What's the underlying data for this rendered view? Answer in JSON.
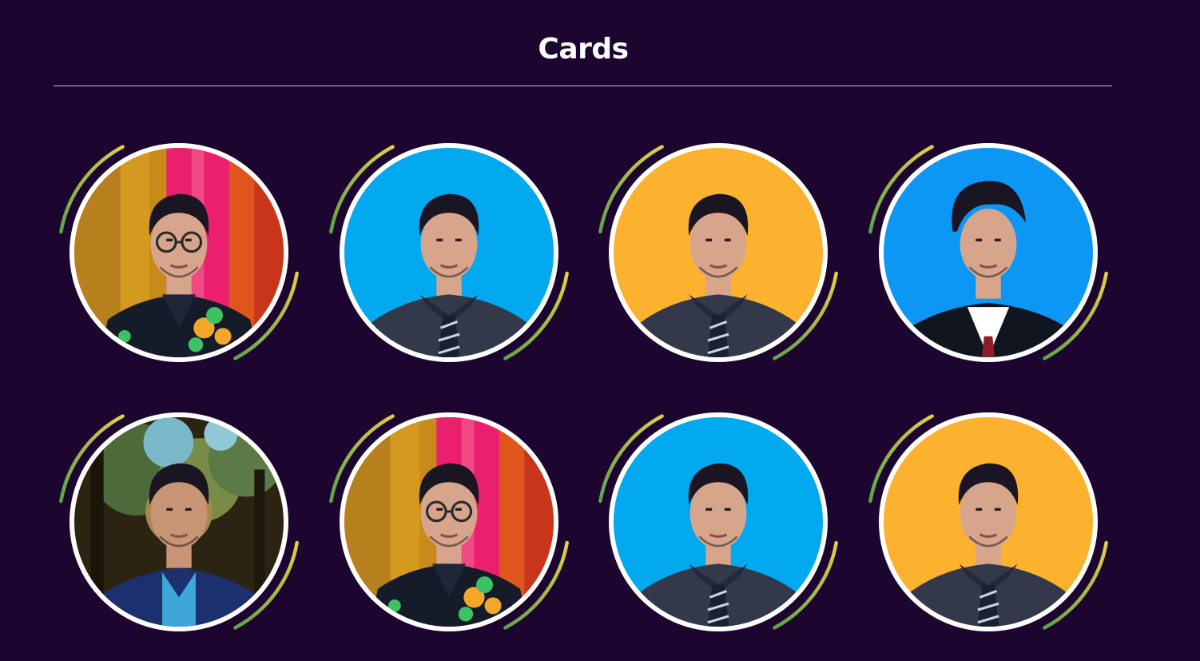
{
  "page": {
    "title": "Cards"
  },
  "theme": {
    "background": "#1c052e",
    "ring": "#ffffff",
    "arc_yellow": "#e2cf45",
    "arc_green": "#5fa24a"
  },
  "cards": [
    {
      "photo": "portrait-photo",
      "background": "festive-curtain",
      "outfit": "dark-embroidered-shirt",
      "glasses": true
    },
    {
      "photo": "portrait-photo",
      "background": "sky-blue",
      "outfit": "dark-shirt-striped-tie",
      "glasses": false
    },
    {
      "photo": "portrait-photo",
      "background": "amber",
      "outfit": "dark-shirt-striped-tie",
      "glasses": false
    },
    {
      "photo": "portrait-photo",
      "background": "bright-blue",
      "outfit": "suit-white-shirt",
      "glasses": false
    },
    {
      "photo": "portrait-photo",
      "background": "trees",
      "outfit": "blue-blazer",
      "glasses": false
    },
    {
      "photo": "portrait-photo",
      "background": "festive-curtain",
      "outfit": "dark-embroidered-shirt",
      "glasses": true
    },
    {
      "photo": "portrait-photo",
      "background": "sky-blue",
      "outfit": "dark-shirt-striped-tie",
      "glasses": false
    },
    {
      "photo": "portrait-photo",
      "background": "amber",
      "outfit": "dark-shirt-striped-tie",
      "glasses": false
    }
  ]
}
